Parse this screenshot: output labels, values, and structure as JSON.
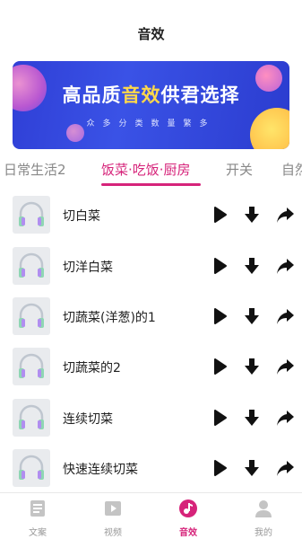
{
  "header": {
    "title": "音效"
  },
  "banner": {
    "headline_before": "高品质",
    "headline_highlight": "音效",
    "headline_after": "供君选择",
    "subtitle": "众多分类数量繁多"
  },
  "tabs": [
    {
      "label": "日常生活2",
      "active": false
    },
    {
      "label": "饭菜·吃饭·厨房",
      "active": true
    },
    {
      "label": "开关",
      "active": false
    },
    {
      "label": "自然",
      "active": false
    }
  ],
  "sounds": [
    {
      "name": "切白菜"
    },
    {
      "name": "切洋白菜"
    },
    {
      "name": "切蔬菜(洋葱)的1"
    },
    {
      "name": "切蔬菜的2"
    },
    {
      "name": "连续切菜"
    },
    {
      "name": "快速连续切菜"
    }
  ],
  "bottom_nav": [
    {
      "label": "文案",
      "icon": "document-icon",
      "active": false
    },
    {
      "label": "视频",
      "icon": "video-icon",
      "active": false
    },
    {
      "label": "音效",
      "icon": "music-disc-icon",
      "active": true
    },
    {
      "label": "我的",
      "icon": "user-icon",
      "active": false
    }
  ],
  "colors": {
    "accent": "#d6237a",
    "banner_blue": "#3a52e6",
    "highlight_yellow": "#ffd84a"
  }
}
